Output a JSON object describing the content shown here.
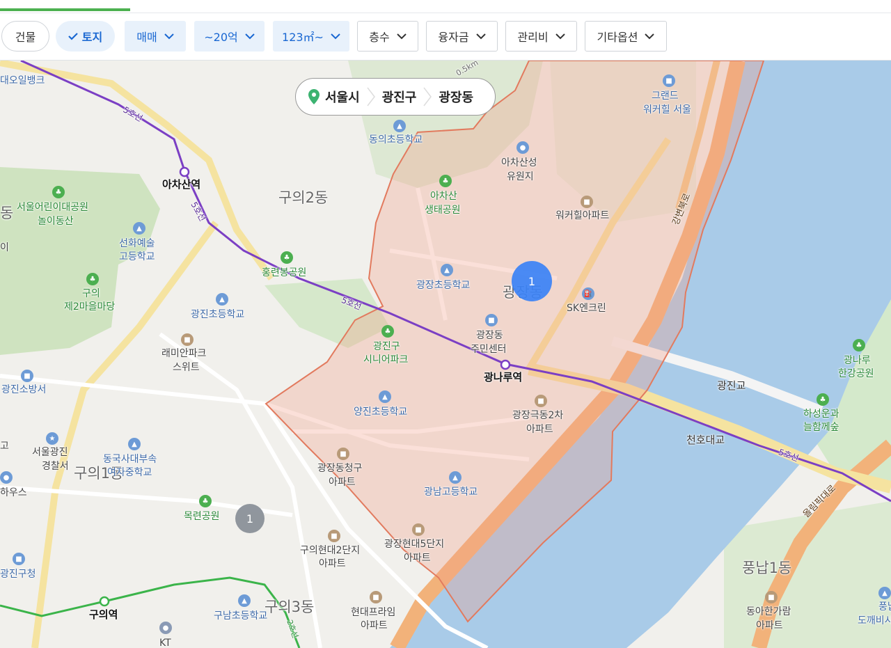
{
  "filters": {
    "building": "건물",
    "land": "토지",
    "trade_type": "매매",
    "price": "~20억",
    "area": "123㎡~",
    "floors": "층수",
    "loan": "융자금",
    "maintenance": "관리비",
    "other_options": "기타옵션"
  },
  "breadcrumb": {
    "city": "서울시",
    "district": "광진구",
    "dong": "광장동"
  },
  "clusters": [
    {
      "count": "1",
      "color": "#3b82f6"
    },
    {
      "count": "1",
      "color": "#8a9099"
    }
  ],
  "map": {
    "areas": {
      "guui2": "구의2동",
      "gwangjang": "광장동",
      "guui1": "구의1동",
      "guui3": "구의3동",
      "pungnap1": "풍납1동",
      "edge_dong": "동"
    },
    "stations": {
      "achasan": "아차산역",
      "gwangnaru": "광나루역",
      "guui": "구의역"
    },
    "roads": {
      "line5": "5호선",
      "line2": "2호선",
      "gangbyeon": "강변북로",
      "olympic": "올림픽대로",
      "gwangjingyo": "광진교",
      "cheonhodaegyo": "천호대교",
      "trail": "0.5km"
    },
    "pois": {
      "oilbank": "대오일뱅크",
      "dongui_school": "동의초등학교",
      "grand_walkerhill_1": "그랜드",
      "grand_walkerhill_2": "워커힐 서울",
      "achasan_ruins_1": "아차산성",
      "achasan_ruins_2": "유원지",
      "achasan_eco_1": "아차산",
      "achasan_eco_2": "생태공원",
      "walkerhill_apt": "워커힐아파트",
      "kids_park_1": "서울어린이대공원",
      "kids_park_2": "놀이동산",
      "arts_hs_1": "선화예술",
      "arts_hs_2": "고등학교",
      "hongryeonbong": "홍련봉공원",
      "gwangjang_es": "광장초등학교",
      "sk_enclean": "SK엔크린",
      "guui_park_1": "구의",
      "guui_park_2": "제2마을마당",
      "gwangjin_es": "광진초등학교",
      "gwangjang_center_1": "광장동",
      "gwangjang_center_2": "주민센터",
      "senior_1": "광진구",
      "senior_2": "시니어파크",
      "ramian_1": "래미안파크",
      "ramian_2": "스위트",
      "fire_station": "광진소방서",
      "yangjin_es": "양진초등학교",
      "geukdong_1": "광장극동2차",
      "geukdong_2": "아파트",
      "police_1": "서울광진",
      "police_2": "경찰서",
      "dongguk_1": "동국사대부속",
      "dongguk_2": "여자중학교",
      "cheonggu_1": "광장동청구",
      "cheonggu_2": "아파트",
      "gwangnam_hs": "광남고등학교",
      "gwangnaru_hangang_1": "광나루",
      "gwangnaru_hangang_2": "한강공원",
      "haseong_1": "하성운과",
      "haseong_2": "늘함께숲",
      "mokryeon": "목련공원",
      "hyundai2_1": "구의현대2단지",
      "hyundai2_2": "아파트",
      "hyundai5_1": "광장현대5단지",
      "hyundai5_2": "아파트",
      "gu_office": "광진구청",
      "gunam_es": "구남초등학교",
      "prime_1": "현대프라임",
      "prime_2": "아파트",
      "kt": "KT",
      "dongahanga_1": "동아한가람",
      "dongahanga_2": "아파트",
      "pungnap_right_1": "풍납",
      "pungnap_right_2": "도깨비시",
      "left_edge_1": "이",
      "left_edge_2": "고",
      "left_edge_3": "하우스"
    }
  },
  "colors": {
    "accent_green": "#4cb050",
    "selected_blue": "#1967d2",
    "river": "#a9cbe8",
    "highlight": "#e27a5e"
  }
}
